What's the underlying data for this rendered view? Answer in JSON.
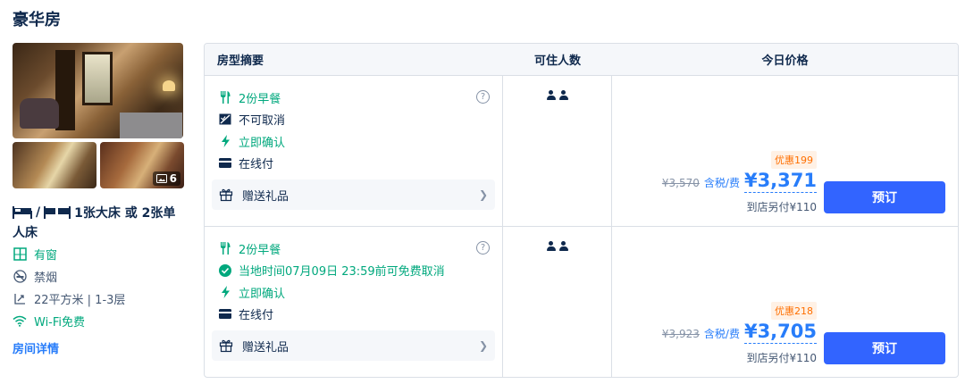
{
  "room": {
    "title": "豪华房",
    "photo_count": "6",
    "bed_text": "1张大床 或 2张单人床",
    "features": [
      {
        "icon": "window-icon",
        "label": "有窗",
        "color": "#00a87d"
      },
      {
        "icon": "no-smoking-icon",
        "label": "禁烟",
        "color": "#455873"
      },
      {
        "icon": "area-icon",
        "label": "22平方米 | 1-3层",
        "color": "#455873"
      },
      {
        "icon": "wifi-icon",
        "label": "Wi-Fi免费",
        "color": "#00a87d"
      }
    ],
    "details_link": "房间详情"
  },
  "table": {
    "headers": [
      "房型摘要",
      "可住人数",
      "今日价格"
    ],
    "rows": [
      {
        "policies": [
          {
            "icon": "utensils-icon",
            "label": "2份早餐",
            "color": "#00a87d"
          },
          {
            "icon": "no-cancel-icon",
            "label": "不可取消",
            "color": "#0f294d"
          },
          {
            "icon": "lightning-icon",
            "label": "立即确认",
            "color": "#00a87d"
          },
          {
            "icon": "card-icon",
            "label": "在线付",
            "color": "#0f294d"
          }
        ],
        "gift": "赠送礼品",
        "guests": 2,
        "discount": "优惠199",
        "old_price": "¥3,570",
        "tax_label": "含税/费",
        "price": "¥3,371",
        "extra": "到店另付¥110",
        "book": "预订"
      },
      {
        "policies": [
          {
            "icon": "utensils-icon",
            "label": "2份早餐",
            "color": "#00a87d"
          },
          {
            "icon": "check-circle-icon",
            "label": "当地时间07月09日 23:59前可免费取消",
            "color": "#00a87d"
          },
          {
            "icon": "lightning-icon",
            "label": "立即确认",
            "color": "#00a87d"
          },
          {
            "icon": "card-icon",
            "label": "在线付",
            "color": "#0f294d"
          }
        ],
        "gift": "赠送礼品",
        "guests": 2,
        "discount": "优惠218",
        "old_price": "¥3,923",
        "tax_label": "含税/费",
        "price": "¥3,705",
        "extra": "到店另付¥110",
        "book": "预订"
      }
    ]
  },
  "colors": {
    "accent": "#287dfa",
    "button": "#3264ff",
    "green": "#00a87d",
    "discount": "#ff6f00"
  }
}
